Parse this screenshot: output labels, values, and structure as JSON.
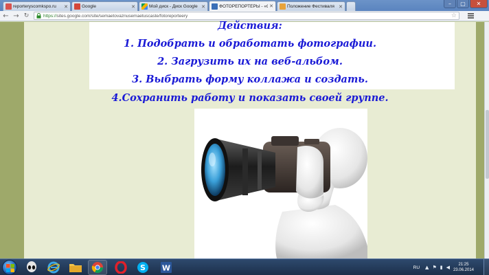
{
  "browser": {
    "tabs": [
      {
        "title": "reporteryscomkspo.ru",
        "favicon_color": "#d9534f"
      },
      {
        "title": "Google",
        "favicon_color": "#d44638"
      },
      {
        "title": "Мой диск - Диск Google",
        "favicon_color": "#f4b400"
      },
      {
        "title": "ФОТОРЕПОРТЁРЫ - «Си",
        "favicon_color": "#3a6fb7"
      },
      {
        "title": "Положение Фестиваля",
        "favicon_color": "#e8a33b"
      }
    ],
    "active_tab": 3,
    "url_scheme": "https://",
    "url_rest": "sites.google.com/site/semaetovaznusemaetuscaste/fotoreporteery"
  },
  "page": {
    "heading": "Действия:",
    "steps": [
      "1. Подобрать  и  обработать фотографии.",
      "2. Загрузить их на веб-альбом.",
      "3. Выбрать форму коллажа и создать.",
      "4.Сохранить работу и показать своей группе."
    ],
    "text_color": "#1a1ad6"
  },
  "taskbar": {
    "language": "RU",
    "time": "21:25",
    "date": "23.06.2014",
    "apps": [
      {
        "name": "alien-app",
        "running": false
      },
      {
        "name": "internet-explorer",
        "running": false
      },
      {
        "name": "file-explorer",
        "running": false
      },
      {
        "name": "chrome",
        "running": true
      },
      {
        "name": "opera",
        "running": false
      },
      {
        "name": "skype",
        "running": false
      },
      {
        "name": "microsoft-word",
        "running": false
      }
    ]
  }
}
